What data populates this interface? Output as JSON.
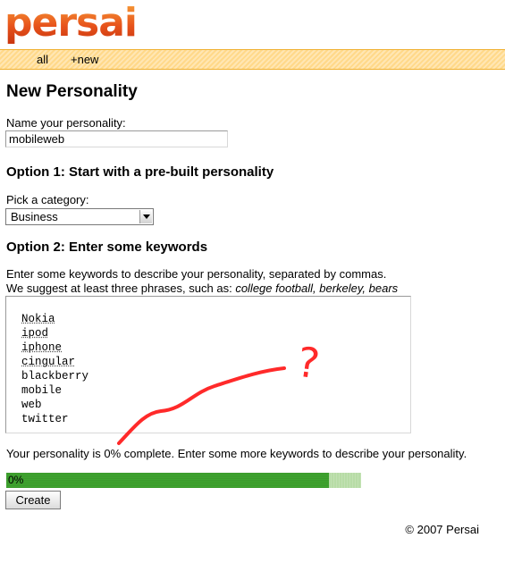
{
  "logo": {
    "text": "persai"
  },
  "nav": {
    "items": [
      {
        "label": "all"
      },
      {
        "label": "+new"
      }
    ]
  },
  "page_title": "New Personality",
  "name_field": {
    "label": "Name your personality:",
    "value": "mobileweb"
  },
  "option1": {
    "heading": "Option 1: Start with a pre-built personality",
    "category_label": "Pick a category:",
    "category_value": "Business"
  },
  "option2": {
    "heading": "Option 2: Enter some keywords",
    "instructions_line1": "Enter some keywords to describe your personality, separated by commas.",
    "instructions_line2_prefix": "We suggest at least three phrases, such as:",
    "instructions_examples": "college football, berkeley, bears",
    "keywords": [
      "Nokia",
      "ipod",
      "iphone",
      "cingular",
      "blackberry",
      "mobile",
      "web",
      "twitter"
    ]
  },
  "status_text": "Your personality is 0% complete. Enter some more keywords to describe your personality.",
  "progress": {
    "label": "0%",
    "fill_fraction": 0.91
  },
  "create_button": {
    "label": "Create"
  },
  "footer": "© 2007 Persai",
  "annotation": {
    "mark": "?",
    "color": "#ff2a2a"
  }
}
